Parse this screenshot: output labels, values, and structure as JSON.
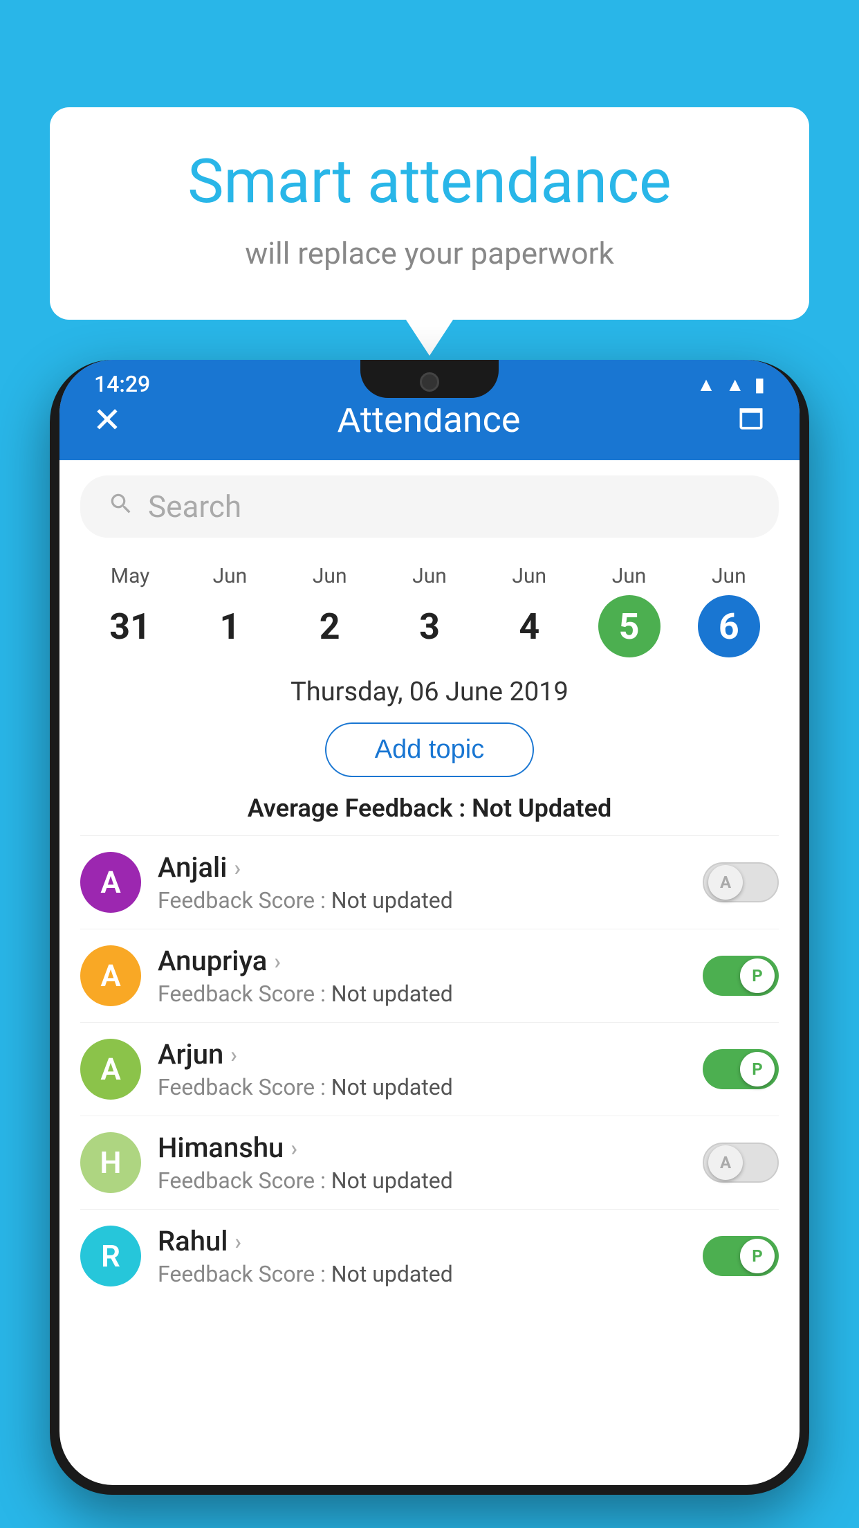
{
  "background_color": "#29b6e8",
  "speech_bubble": {
    "title": "Smart attendance",
    "subtitle": "will replace your paperwork"
  },
  "status_bar": {
    "time": "14:29",
    "icons": [
      "wifi",
      "signal",
      "battery"
    ]
  },
  "app_bar": {
    "close_label": "✕",
    "title": "Attendance",
    "calendar_icon": "🗓"
  },
  "search": {
    "placeholder": "Search"
  },
  "calendar": {
    "days": [
      {
        "month": "May",
        "date": "31",
        "state": "normal"
      },
      {
        "month": "Jun",
        "date": "1",
        "state": "normal"
      },
      {
        "month": "Jun",
        "date": "2",
        "state": "normal"
      },
      {
        "month": "Jun",
        "date": "3",
        "state": "normal"
      },
      {
        "month": "Jun",
        "date": "4",
        "state": "normal"
      },
      {
        "month": "Jun",
        "date": "5",
        "state": "active-green"
      },
      {
        "month": "Jun",
        "date": "6",
        "state": "active-blue"
      }
    ]
  },
  "selected_date": "Thursday, 06 June 2019",
  "add_topic_label": "Add topic",
  "avg_feedback": {
    "label": "Average Feedback : ",
    "value": "Not Updated"
  },
  "students": [
    {
      "name": "Anjali",
      "avatar_letter": "A",
      "avatar_color": "#9c27b0",
      "feedback_label": "Feedback Score : ",
      "feedback_value": "Not updated",
      "attendance": "absent"
    },
    {
      "name": "Anupriya",
      "avatar_letter": "A",
      "avatar_color": "#f9a825",
      "feedback_label": "Feedback Score : ",
      "feedback_value": "Not updated",
      "attendance": "present"
    },
    {
      "name": "Arjun",
      "avatar_letter": "A",
      "avatar_color": "#8bc34a",
      "feedback_label": "Feedback Score : ",
      "feedback_value": "Not updated",
      "attendance": "present"
    },
    {
      "name": "Himanshu",
      "avatar_letter": "H",
      "avatar_color": "#aed581",
      "feedback_label": "Feedback Score : ",
      "feedback_value": "Not updated",
      "attendance": "absent"
    },
    {
      "name": "Rahul",
      "avatar_letter": "R",
      "avatar_color": "#26c6da",
      "feedback_label": "Feedback Score : ",
      "feedback_value": "Not updated",
      "attendance": "present"
    }
  ]
}
